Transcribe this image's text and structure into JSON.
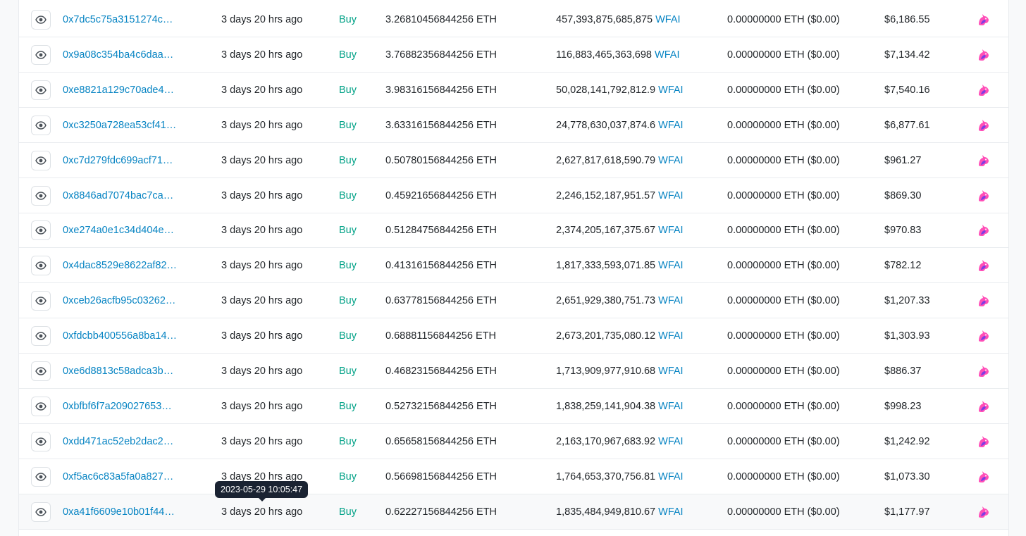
{
  "colors": {
    "link": "#0784c3",
    "buy": "#00a186",
    "tooltip_bg": "#1a2332"
  },
  "icons": {
    "view": "eye-icon",
    "dex": "uniswap-icon"
  },
  "tooltip": "2023-05-29 10:05:47",
  "rows": [
    {
      "hash": "0x7dc5c75a3151274c…",
      "age": "3 days 20 hrs ago",
      "type": "Buy",
      "eth": "3.26810456844256 ETH",
      "amount": "457,393,875,685,875",
      "token": "WFAI",
      "price": "0.00000000 ETH ($0.00)",
      "value": "$6,186.55"
    },
    {
      "hash": "0x9a08c354ba4c6daa…",
      "age": "3 days 20 hrs ago",
      "type": "Buy",
      "eth": "3.76882356844256 ETH",
      "amount": "116,883,465,363,698",
      "token": "WFAI",
      "price": "0.00000000 ETH ($0.00)",
      "value": "$7,134.42"
    },
    {
      "hash": "0xe8821a129c70ade4…",
      "age": "3 days 20 hrs ago",
      "type": "Buy",
      "eth": "3.98316156844256 ETH",
      "amount": "50,028,141,792,812.9",
      "token": "WFAI",
      "price": "0.00000000 ETH ($0.00)",
      "value": "$7,540.16"
    },
    {
      "hash": "0xc3250a728ea53cf41…",
      "age": "3 days 20 hrs ago",
      "type": "Buy",
      "eth": "3.63316156844256 ETH",
      "amount": "24,778,630,037,874.6",
      "token": "WFAI",
      "price": "0.00000000 ETH ($0.00)",
      "value": "$6,877.61"
    },
    {
      "hash": "0xc7d279fdc699acf71…",
      "age": "3 days 20 hrs ago",
      "type": "Buy",
      "eth": "0.50780156844256 ETH",
      "amount": "2,627,817,618,590.79",
      "token": "WFAI",
      "price": "0.00000000 ETH ($0.00)",
      "value": "$961.27"
    },
    {
      "hash": "0x8846ad7074bac7ca…",
      "age": "3 days 20 hrs ago",
      "type": "Buy",
      "eth": "0.45921656844256 ETH",
      "amount": "2,246,152,187,951.57",
      "token": "WFAI",
      "price": "0.00000000 ETH ($0.00)",
      "value": "$869.30"
    },
    {
      "hash": "0xe274a0e1c34d404e…",
      "age": "3 days 20 hrs ago",
      "type": "Buy",
      "eth": "0.51284756844256 ETH",
      "amount": "2,374,205,167,375.67",
      "token": "WFAI",
      "price": "0.00000000 ETH ($0.00)",
      "value": "$970.83"
    },
    {
      "hash": "0x4dac8529e8622af82…",
      "age": "3 days 20 hrs ago",
      "type": "Buy",
      "eth": "0.41316156844256 ETH",
      "amount": "1,817,333,593,071.85",
      "token": "WFAI",
      "price": "0.00000000 ETH ($0.00)",
      "value": "$782.12"
    },
    {
      "hash": "0xceb26acfb95c03262…",
      "age": "3 days 20 hrs ago",
      "type": "Buy",
      "eth": "0.63778156844256 ETH",
      "amount": "2,651,929,380,751.73",
      "token": "WFAI",
      "price": "0.00000000 ETH ($0.00)",
      "value": "$1,207.33"
    },
    {
      "hash": "0xfdcbb400556a8ba14…",
      "age": "3 days 20 hrs ago",
      "type": "Buy",
      "eth": "0.68881156844256 ETH",
      "amount": "2,673,201,735,080.12",
      "token": "WFAI",
      "price": "0.00000000 ETH ($0.00)",
      "value": "$1,303.93"
    },
    {
      "hash": "0xe6d8813c58adca3b…",
      "age": "3 days 20 hrs ago",
      "type": "Buy",
      "eth": "0.46823156844256 ETH",
      "amount": "1,713,909,977,910.68",
      "token": "WFAI",
      "price": "0.00000000 ETH ($0.00)",
      "value": "$886.37"
    },
    {
      "hash": "0xbfbf6f7a209027653…",
      "age": "3 days 20 hrs ago",
      "type": "Buy",
      "eth": "0.52732156844256 ETH",
      "amount": "1,838,259,141,904.38",
      "token": "WFAI",
      "price": "0.00000000 ETH ($0.00)",
      "value": "$998.23"
    },
    {
      "hash": "0xdd471ac52eb2dac2…",
      "age": "3 days 20 hrs ago",
      "type": "Buy",
      "eth": "0.65658156844256 ETH",
      "amount": "2,163,170,967,683.92",
      "token": "WFAI",
      "price": "0.00000000 ETH ($0.00)",
      "value": "$1,242.92"
    },
    {
      "hash": "0xf5ac6c83a5fa0a827…",
      "age": "3 days 20 hrs ago",
      "type": "Buy",
      "eth": "0.56698156844256 ETH",
      "amount": "1,764,653,370,756.81",
      "token": "WFAI",
      "price": "0.00000000 ETH ($0.00)",
      "value": "$1,073.30"
    },
    {
      "hash": "0xa41f6609e10b01f44…",
      "age": "3 days 20 hrs ago",
      "type": "Buy",
      "eth": "0.62227156844256 ETH",
      "amount": "1,835,484,949,810.67",
      "token": "WFAI",
      "price": "0.00000000 ETH ($0.00)",
      "value": "$1,177.97"
    }
  ]
}
